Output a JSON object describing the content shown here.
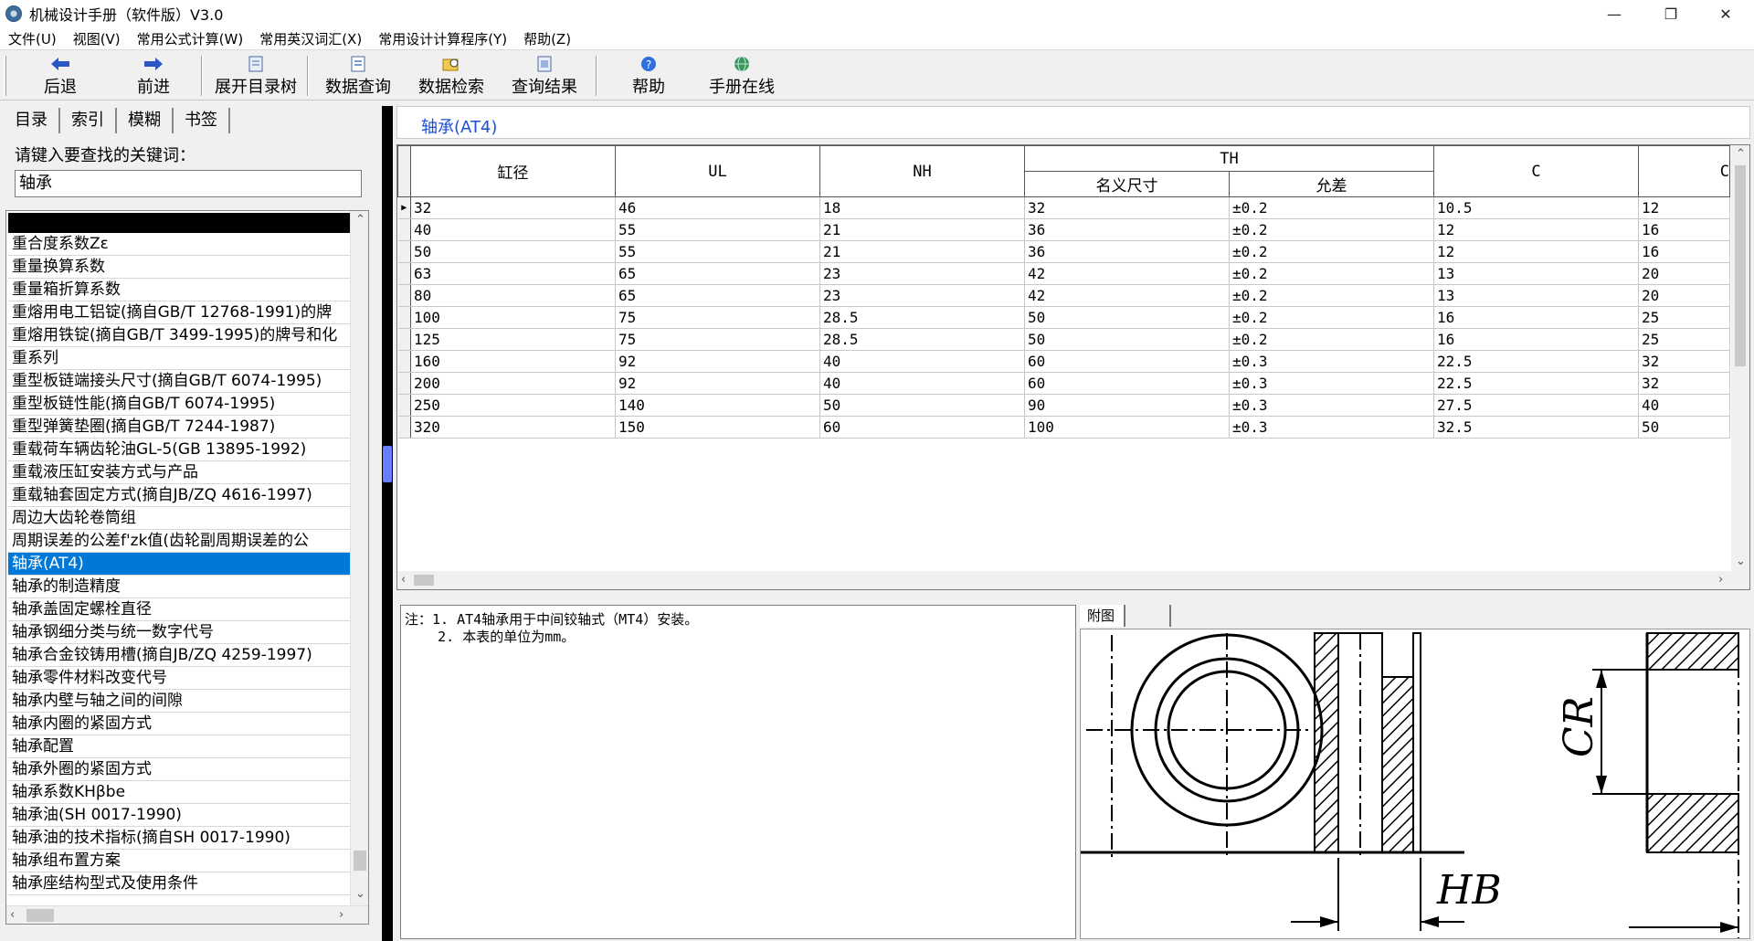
{
  "window": {
    "title": "机械设计手册（软件版）V3.0"
  },
  "menu": [
    "文件(U)",
    "视图(V)",
    "常用公式计算(W)",
    "常用英汉词汇(X)",
    "常用设计计算程序(Y)",
    "帮助(Z)"
  ],
  "toolbar": {
    "back": "后退",
    "forward": "前进",
    "expand_tree": "展开目录树",
    "data_query": "数据查询",
    "data_search": "数据检索",
    "query_results": "查询结果",
    "help": "帮助",
    "online": "手册在线"
  },
  "left": {
    "tabs": [
      "目录",
      "索引",
      "模糊",
      "书签"
    ],
    "prompt": "请键入要查找的关键词：",
    "keyword": "轴承",
    "items": [
      "重合度系数Zε",
      "重量换算系数",
      "重量箱折算系数",
      "重熔用电工铝锭(摘自GB/T 12768-1991)的牌",
      "重熔用铁锭(摘自GB/T 3499-1995)的牌号和化",
      "重系列",
      "重型板链端接头尺寸(摘自GB/T 6074-1995)",
      "重型板链性能(摘自GB/T 6074-1995)",
      "重型弹簧垫圈(摘自GB/T 7244-1987)",
      "重载荷车辆齿轮油GL-5(GB 13895-1992)",
      "重载液压缸安装方式与产品",
      "重载轴套固定方式(摘自JB/ZQ 4616-1997)",
      "周边大齿轮卷筒组",
      "周期误差的公差f'zk值(齿轮副周期误差的公",
      "轴承(AT4)",
      "轴承的制造精度",
      "轴承盖固定螺栓直径",
      "轴承钢细分类与统一数字代号",
      "轴承合金铰铸用槽(摘自JB/ZQ 4259-1997)",
      "轴承零件材料改变代号",
      "轴承内壁与轴之间的间隙",
      "轴承内圈的紧固方式",
      "轴承配置",
      "轴承外圈的紧固方式",
      "轴承系数KHβbe",
      "轴承油(SH 0017-1990)",
      "轴承油的技术指标(摘自SH 0017-1990)",
      "轴承组布置方案",
      "轴承座结构型式及使用条件"
    ],
    "selected_index": 14
  },
  "right": {
    "heading": "轴承(AT4)",
    "columns": {
      "c1": "缸径",
      "c2": "UL",
      "c3": "NH",
      "th": "TH",
      "th_a": "名义尺寸",
      "th_b": "允差",
      "c6": "C",
      "c7": "C"
    },
    "rows": [
      [
        "32",
        "46",
        "18",
        "32",
        "±0.2",
        "10.5",
        "12"
      ],
      [
        "40",
        "55",
        "21",
        "36",
        "±0.2",
        "12",
        "16"
      ],
      [
        "50",
        "55",
        "21",
        "36",
        "±0.2",
        "12",
        "16"
      ],
      [
        "63",
        "65",
        "23",
        "42",
        "±0.2",
        "13",
        "20"
      ],
      [
        "80",
        "65",
        "23",
        "42",
        "±0.2",
        "13",
        "20"
      ],
      [
        "100",
        "75",
        "28.5",
        "50",
        "±0.2",
        "16",
        "25"
      ],
      [
        "125",
        "75",
        "28.5",
        "50",
        "±0.2",
        "16",
        "25"
      ],
      [
        "160",
        "92",
        "40",
        "60",
        "±0.3",
        "22.5",
        "32"
      ],
      [
        "200",
        "92",
        "40",
        "60",
        "±0.3",
        "22.5",
        "32"
      ],
      [
        "250",
        "140",
        "50",
        "90",
        "±0.3",
        "27.5",
        "40"
      ],
      [
        "320",
        "150",
        "60",
        "100",
        "±0.3",
        "32.5",
        "50"
      ]
    ],
    "notes": "注：1. AT4轴承用于中间铰轴式（MT4）安装。\n    2. 本表的单位为mm。",
    "figure_tabs": [
      "附图",
      ""
    ],
    "figure_labels": {
      "cr": "CR",
      "hb": "HB"
    }
  }
}
